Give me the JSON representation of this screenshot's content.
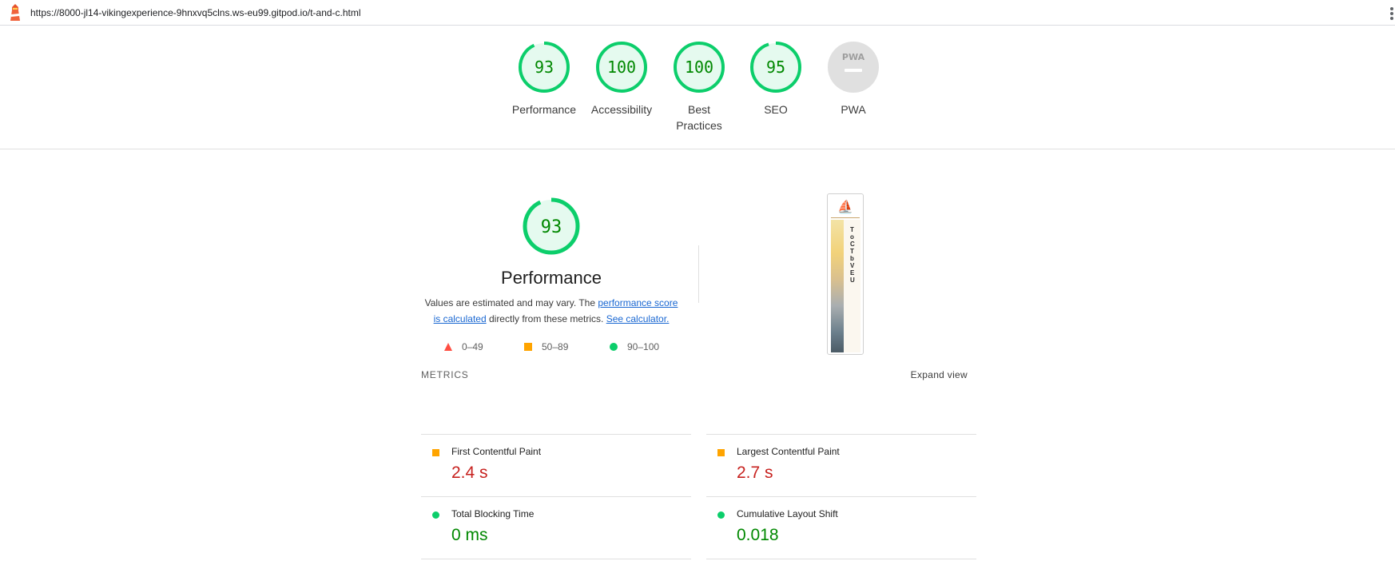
{
  "browser": {
    "url": "https://8000-jl14-vikingexperience-9hnxvq5clns.ws-eu99.gitpod.io/t-and-c.html"
  },
  "colors": {
    "pass": "#0cce6b",
    "pass_text": "#008800",
    "pass_fill": "#e5faef",
    "average": "#ffa400",
    "fail": "#ff4e42",
    "fail_text": "#c7221f",
    "na": "#e0e0e0"
  },
  "summary": {
    "gauges": [
      {
        "id": "performance",
        "score": "93",
        "label": "Performance",
        "percent": 93
      },
      {
        "id": "accessibility",
        "score": "100",
        "label": "Accessibility",
        "percent": 100
      },
      {
        "id": "best-practices",
        "score": "100",
        "label": "Best Practices",
        "percent": 100
      },
      {
        "id": "seo",
        "score": "95",
        "label": "SEO",
        "percent": 95
      },
      {
        "id": "pwa",
        "score": "",
        "label": "PWA",
        "badge": "PWA",
        "percent": 0
      }
    ]
  },
  "performance": {
    "score": "93",
    "percent": 93,
    "title": "Performance",
    "desc_prefix": "Values are estimated and may vary. The ",
    "desc_link1": "performance score is calculated",
    "desc_middle": " directly from these metrics. ",
    "desc_link2": "See calculator.",
    "legend": [
      {
        "range": "0–49",
        "shape": "triangle-icon"
      },
      {
        "range": "50–89",
        "shape": "square-icon"
      },
      {
        "range": "90–100",
        "shape": "circle-icon"
      }
    ],
    "thumbnail_text": "ToCTbVEU"
  },
  "metrics": {
    "title": "METRICS",
    "expand_label": "Expand view",
    "items": [
      {
        "name": "First Contentful Paint",
        "value": "2.4 s",
        "rating": "average"
      },
      {
        "name": "Largest Contentful Paint",
        "value": "2.7 s",
        "rating": "average"
      },
      {
        "name": "Total Blocking Time",
        "value": "0 ms",
        "rating": "pass"
      },
      {
        "name": "Cumulative Layout Shift",
        "value": "0.018",
        "rating": "pass"
      }
    ]
  }
}
